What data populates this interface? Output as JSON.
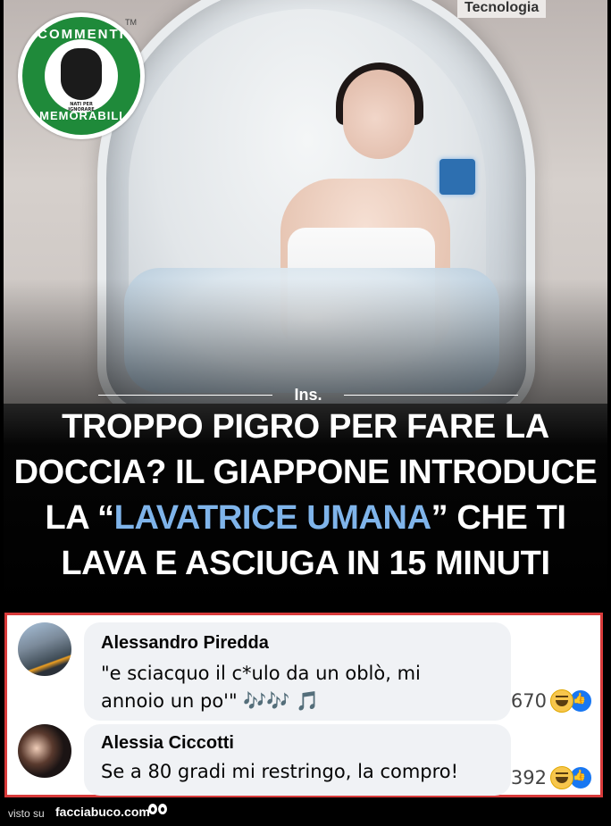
{
  "post": {
    "category_tag": "Tecnologia",
    "logo": {
      "top_text": "COMMENTI",
      "bottom_text": "MEMORABILI",
      "inner_text": "NATI PER IGNORARE",
      "trademark": "TM"
    },
    "source_label": "Ins.",
    "headline": {
      "part1": "TROPPO PIGRO PER FARE LA DOCCIA? IL GIAPPONE INTRODUCE LA “",
      "highlight": "LAVATRICE UMANA",
      "part2": "” CHE TI LAVA E ASCIUGA IN 15 MINUTI"
    }
  },
  "comments": [
    {
      "author": "Alessandro Piredda",
      "text": "\"e sciacquo il c*ulo da un oblò, mi\nannoio un po'\" 🎶🎶 🎵",
      "reaction_count": "670"
    },
    {
      "author": "Alessia Ciccotti",
      "text": "Se a 80 gradi mi restringo, la compro!",
      "reaction_count": "392"
    }
  ],
  "footer": {
    "visto_label": "visto su",
    "site": "facciabuco.com"
  },
  "colors": {
    "highlight_blue": "#7fb4ea",
    "comments_border": "#d83a3a",
    "logo_green": "#1f8a3a"
  }
}
